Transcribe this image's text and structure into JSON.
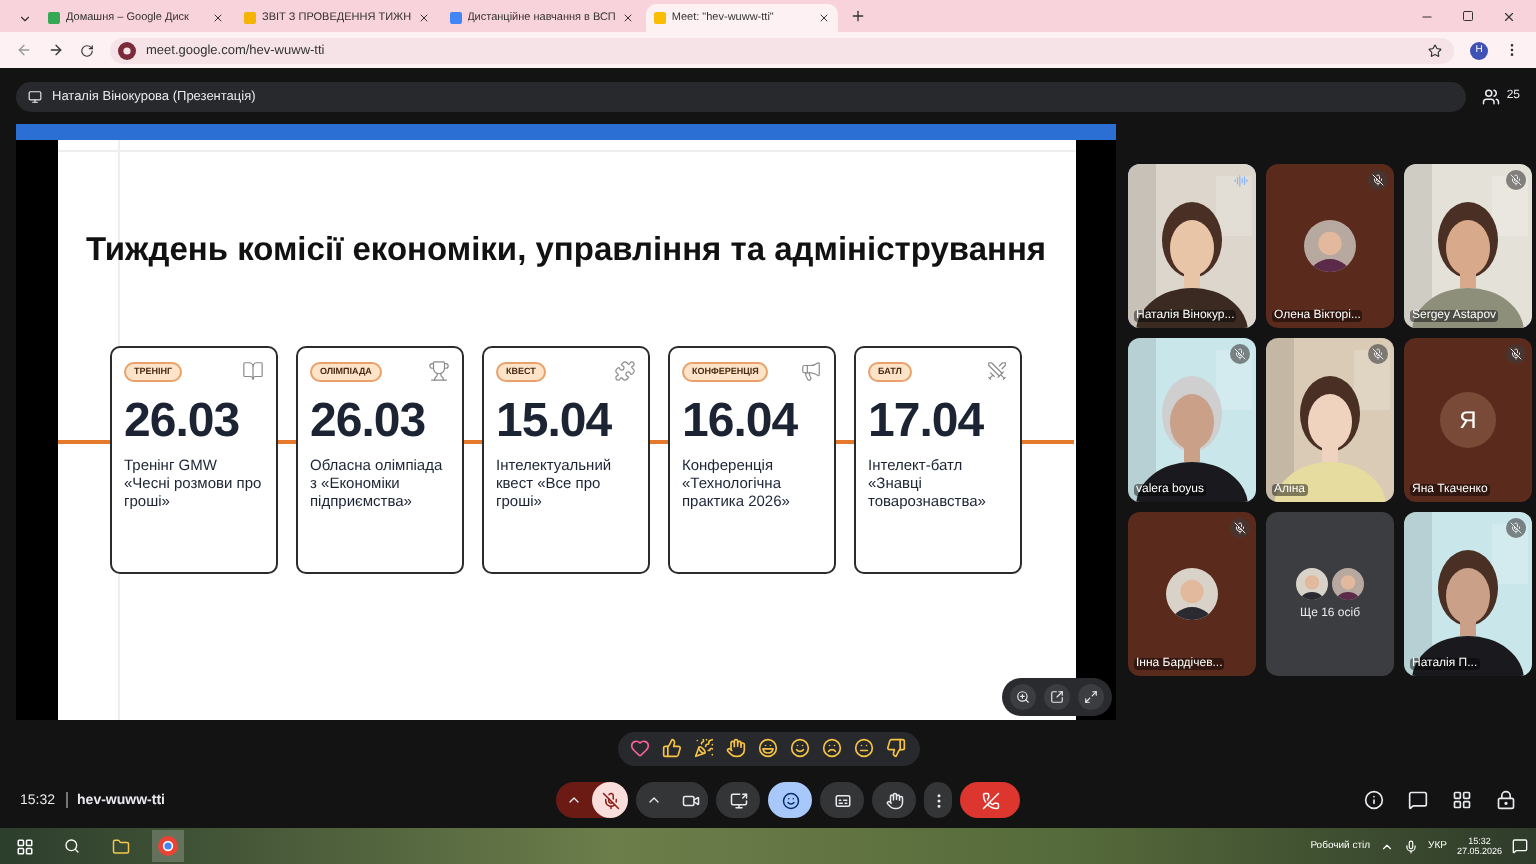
{
  "browser": {
    "tabs": [
      {
        "title": "Домашня – Google Диск",
        "selected": false
      },
      {
        "title": "ЗВІТ З ПРОВЕДЕННЯ ТИЖН",
        "selected": false
      },
      {
        "title": "Дистанційне навчання в ВСП",
        "selected": false
      },
      {
        "title": "Meet: \"hev-wuww-tti\"",
        "selected": true
      }
    ],
    "url": "meet.google.com/hev-wuww-tti",
    "profile": "Н"
  },
  "presenter": "Наталія Вінокурова (Презентація)",
  "participants_count": "25",
  "slide": {
    "title": "Тиждень комісії економіки, управління та адміністрування",
    "cards": [
      {
        "tag": "ТРЕНІНГ",
        "date": "26.03",
        "text": "Тренінг GMW «Чесні розмови про гроші»"
      },
      {
        "tag": "ОЛІМПІАДА",
        "date": "26.03",
        "text": "Обласна олімпіада з «Економіки підприємства»"
      },
      {
        "tag": "КВЕСТ",
        "date": "15.04",
        "text": "Інтелектуальний квест «Все про гроші»"
      },
      {
        "tag": "КОНФЕРЕНЦІЯ",
        "date": "16.04",
        "text": "Конференція «Технологічна практика 2026»"
      },
      {
        "tag": "БАТЛ",
        "date": "17.04",
        "text": "Інтелект-батл «Знавці товарознавства»"
      }
    ]
  },
  "tiles": [
    {
      "kind": "video",
      "name": "Наталія Вінокур...",
      "speaking": true
    },
    {
      "kind": "avatar",
      "name": "Олена Вікторі...",
      "speaking": false
    },
    {
      "kind": "video",
      "name": "Sergey Astapov",
      "speaking": false
    },
    {
      "kind": "video",
      "name": "valera boyus",
      "speaking": false
    },
    {
      "kind": "video",
      "name": "Аліна",
      "speaking": false
    },
    {
      "kind": "initial",
      "initial": "Я",
      "name": "Яна Ткаченко",
      "speaking": false
    },
    {
      "kind": "avatar",
      "name": "Інна Бардічев...",
      "speaking": false
    },
    {
      "kind": "more",
      "name": "Ще 16 осіб"
    },
    {
      "kind": "video",
      "name": "Наталія П...",
      "speaking": false
    }
  ],
  "meeting": {
    "time": "15:32",
    "code": "hev-wuww-tti"
  },
  "controls": [
    {
      "kind": "mic",
      "muted": true
    },
    {
      "kind": "camera"
    },
    {
      "kind": "present"
    },
    {
      "kind": "reactions",
      "selected": true
    },
    {
      "kind": "captions",
      "selected": false
    },
    {
      "kind": "hand",
      "selected": false
    },
    {
      "kind": "more"
    },
    {
      "kind": "leave"
    }
  ],
  "taskbar": {
    "desktop": "Робочий стіл",
    "language": "УКР",
    "time": "15:32",
    "date": "27.05.2026"
  }
}
